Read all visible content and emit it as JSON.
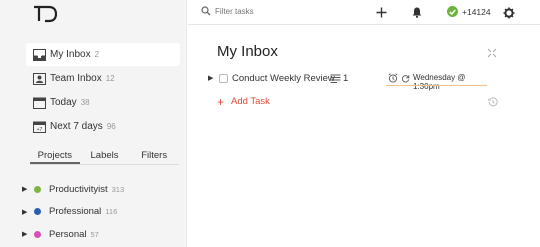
{
  "app": {
    "logo_text": "TD"
  },
  "search": {
    "placeholder": "Filter tasks"
  },
  "karma": {
    "value": "+14124"
  },
  "nav": [
    {
      "label": "My Inbox",
      "count": "2",
      "icon": "inbox-icon"
    },
    {
      "label": "Team Inbox",
      "count": "12",
      "icon": "team-inbox-icon"
    },
    {
      "label": "Today",
      "count": "38",
      "icon": "calendar-today-icon"
    },
    {
      "label": "Next 7 days",
      "count": "96",
      "icon": "calendar-week-icon"
    }
  ],
  "tabs": [
    "Projects",
    "Labels",
    "Filters"
  ],
  "projects": [
    {
      "label": "Productivityist",
      "count": "313",
      "color": "#7cb342"
    },
    {
      "label": "Professional",
      "count": "116",
      "color": "#2a5fb4"
    },
    {
      "label": "Personal",
      "count": "57",
      "color": "#d94fb5"
    }
  ],
  "main": {
    "title": "My Inbox",
    "tasks": [
      {
        "text": "Conduct Weekly Review",
        "notes": "1",
        "due": "Wednesday @ 1:30pm"
      }
    ],
    "add_task": "Add Task"
  },
  "colors": {
    "accent": "#dd4b39",
    "karma": "#6eb33f"
  }
}
